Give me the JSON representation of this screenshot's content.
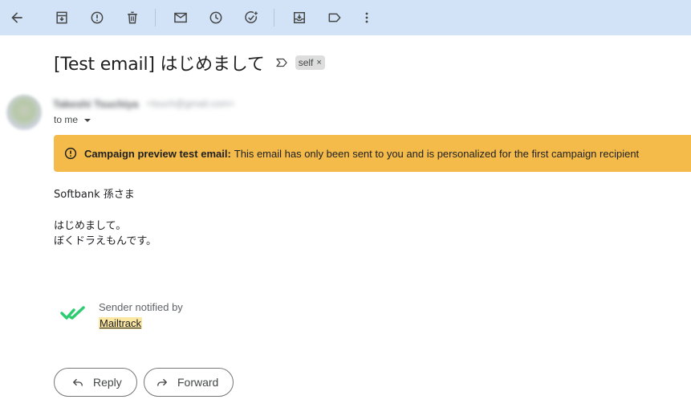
{
  "toolbar": {
    "buttons": [
      {
        "name": "back-arrow-icon",
        "title": "Back"
      },
      {
        "name": "archive-icon",
        "title": "Archive"
      },
      {
        "name": "report-spam-icon",
        "title": "Report spam"
      },
      {
        "name": "delete-icon",
        "title": "Delete"
      },
      {
        "name": "mark-unread-icon",
        "title": "Mark as unread"
      },
      {
        "name": "snooze-clock-icon",
        "title": "Snooze"
      },
      {
        "name": "add-task-icon",
        "title": "Add to tasks"
      },
      {
        "name": "move-to-icon",
        "title": "Move to"
      },
      {
        "name": "label-icon",
        "title": "Labels"
      },
      {
        "name": "more-vert-icon",
        "title": "More"
      }
    ],
    "background": "#d3e3f7"
  },
  "message": {
    "subject": "[Test email] はじめまして",
    "label_chip": "self",
    "label_remove": "×",
    "sender_name": "Takeshi Tsuchiya",
    "sender_email": "<tsuch@gmail.com>",
    "recipient": "to me"
  },
  "banner": {
    "bold_text": "Campaign preview test email:",
    "text": "This email has only been sent to you and is personalized for the first campaign recipient",
    "color": "#f4bb4b"
  },
  "body": {
    "greeting": "Softbank 孫さま",
    "line1": "はじめまして。",
    "line2": "ぼくドラえもんです。"
  },
  "mailtrack": {
    "notified_text": "Sender notified by",
    "link_text": "Mailtrack",
    "check_color": "#2ecc71"
  },
  "actions": {
    "reply_label": "Reply",
    "forward_label": "Forward"
  }
}
